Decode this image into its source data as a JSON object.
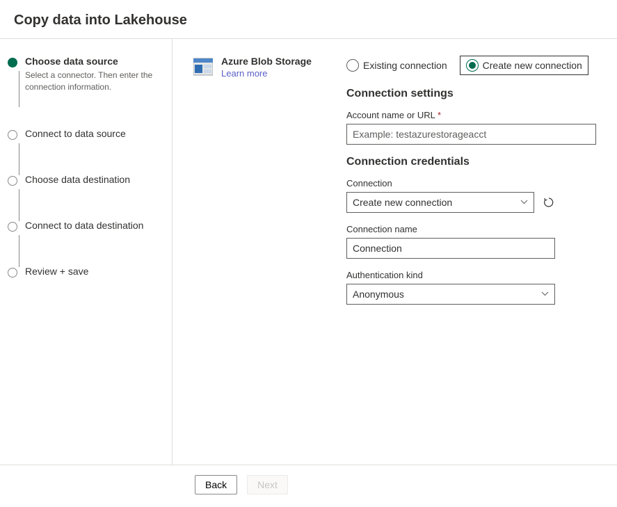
{
  "dialog": {
    "title": "Copy data into Lakehouse"
  },
  "steps": [
    {
      "title": "Choose data source",
      "desc": "Select a connector. Then enter the connection information.",
      "active": true
    },
    {
      "title": "Connect to data source"
    },
    {
      "title": "Choose data destination"
    },
    {
      "title": "Connect to data destination"
    },
    {
      "title": "Review + save"
    }
  ],
  "connector": {
    "name": "Azure Blob Storage",
    "learn_more": "Learn more"
  },
  "connection_mode": {
    "existing_label": "Existing connection",
    "new_label": "Create new connection"
  },
  "settings": {
    "heading": "Connection settings",
    "account": {
      "label": "Account name or URL",
      "placeholder": "Example: testazurestorageacct"
    }
  },
  "credentials": {
    "heading": "Connection credentials",
    "connection": {
      "label": "Connection",
      "value": "Create new connection"
    },
    "name": {
      "label": "Connection name",
      "value": "Connection"
    },
    "auth": {
      "label": "Authentication kind",
      "value": "Anonymous"
    }
  },
  "footer": {
    "back": "Back",
    "next": "Next"
  }
}
